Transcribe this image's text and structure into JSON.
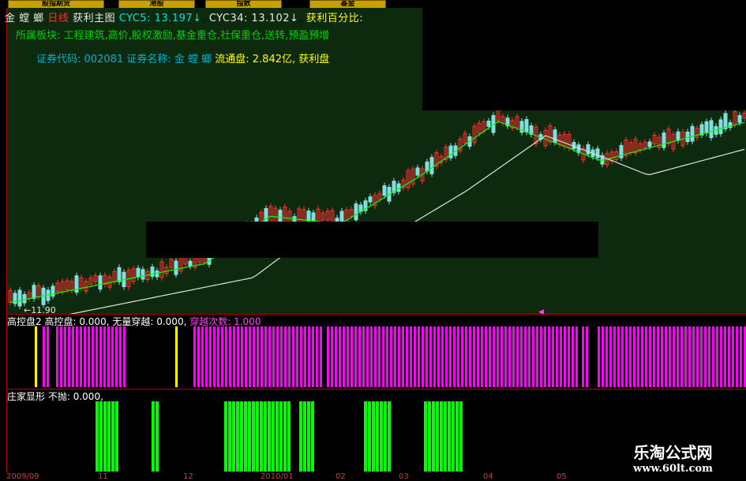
{
  "tabs": [
    "股指期货",
    "港股",
    "指数",
    "基金"
  ],
  "header": {
    "stock_name": "金 螳 螂",
    "period": "日线",
    "template": "获利主图",
    "cyc5_label": "CYC5:",
    "cyc5_value": "13.197↓",
    "cyc34_label": "CYC34:",
    "cyc34_value": "13.102↓",
    "profit_pct_label": "获利百分比:",
    "sector_line": "所属板块: 工程建筑,高价,股权激励,基金重仓,社保重仓,送转,预盈预增",
    "code_label": "证券代码:",
    "code": "002081",
    "name_label": "证券名称:",
    "name": "金 螳 螂",
    "float_label": "流通盘:",
    "float_value": "2.842亿,",
    "profit_plate_label": "获利盘"
  },
  "price_low_marker": "←11.90",
  "panel2": {
    "title": "高控盘2",
    "label1": "高控盘:",
    "value1": "0.000,",
    "label2": "无量穿越:",
    "value2": "0.000,",
    "label3": "穿越次数:",
    "value3": "1.000"
  },
  "panel3": {
    "title": "庄家显形",
    "label1": "不抛:",
    "value1": "0.000,"
  },
  "x_axis": [
    "2009/09",
    "11",
    "12",
    "2010/01",
    "02",
    "03",
    "04",
    "05"
  ],
  "watermark": {
    "line1": "乐淘公式网",
    "line2": "www.60lt.com"
  },
  "colors": {
    "up_candle": "#ff3030",
    "down_candle": "#80e0e0",
    "ma_short": "#00ff00",
    "ma_long": "#e0e0e0",
    "magenta_bar": "#ff00ff",
    "yellow_bar": "#ffff00",
    "green_bar": "#00ff00",
    "main_bg": "#0e2a0e"
  }
}
